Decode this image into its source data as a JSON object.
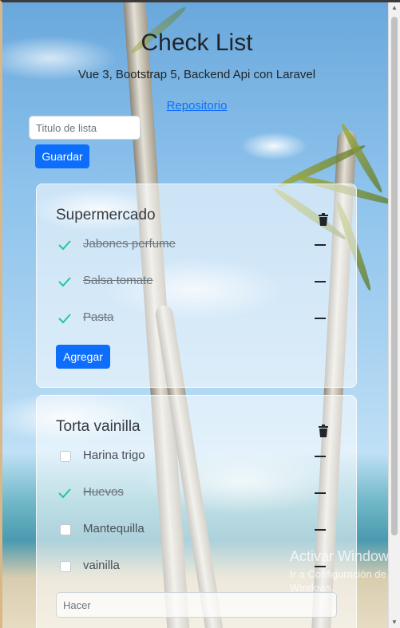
{
  "header": {
    "title": "Check List",
    "subtitle": "Vue 3, Bootstrap 5, Backend Api con Laravel",
    "repo_link": "Repositorio"
  },
  "new_list": {
    "placeholder": "Titulo de lista",
    "value": "",
    "save_label": "Guardar"
  },
  "lists": [
    {
      "title": "Supermercado",
      "items": [
        {
          "label": "Jabones perfume",
          "done": true
        },
        {
          "label": "Salsa tomate",
          "done": true
        },
        {
          "label": "Pasta",
          "done": true
        }
      ],
      "add_label": "Agregar"
    },
    {
      "title": "Torta vainilla",
      "items": [
        {
          "label": "Harina trigo",
          "done": false
        },
        {
          "label": "Huevos",
          "done": true
        },
        {
          "label": "Mantequilla",
          "done": false
        },
        {
          "label": "vainilla",
          "done": false
        }
      ],
      "input_placeholder": "Hacer"
    }
  ],
  "watermark": {
    "line1": "Activar Windows",
    "line2": "Ir a Configuración de PC para activar",
    "line3": "Windows."
  },
  "colors": {
    "primary": "#0d6efd",
    "check": "#20c997"
  }
}
